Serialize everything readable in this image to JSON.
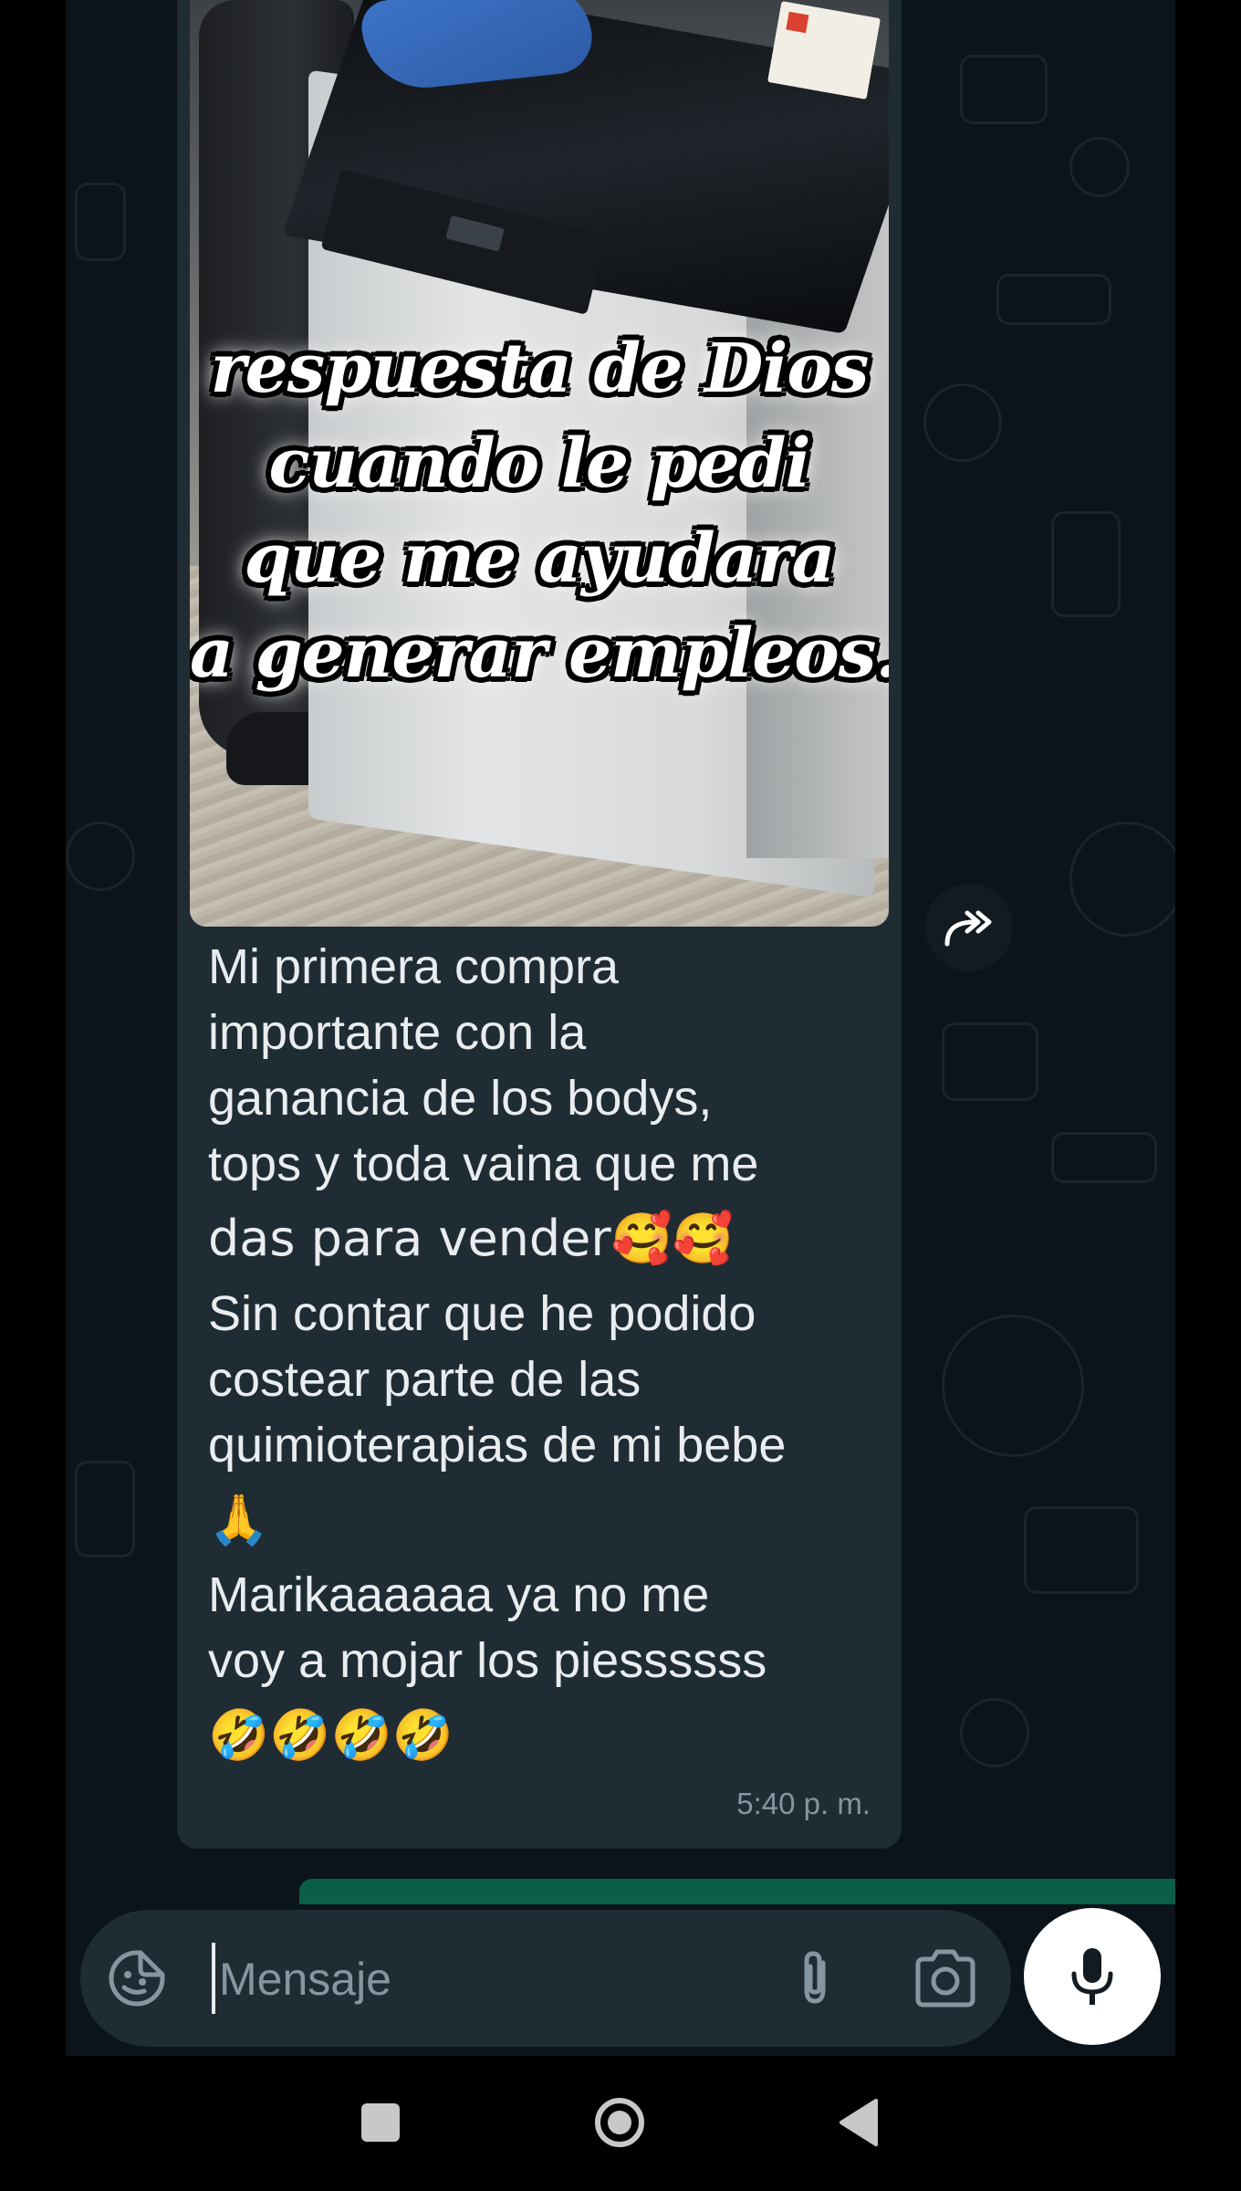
{
  "message": {
    "media_caption_lines": [
      "respuesta de Dios",
      "cuando le pedi",
      "que me ayudara",
      "a generar empleos."
    ],
    "text_lines": [
      "Mi primera compra",
      "importante con la",
      "ganancia de los bodys,",
      "tops y toda vaina que me",
      "das para vender🥰🥰",
      "Sin contar que he podido",
      "costear parte de las",
      "quimioterapias de mi bebe",
      "🙏",
      "Marikaaaaaa ya no me",
      "voy a mojar los piessssss",
      "🤣🤣🤣🤣"
    ],
    "timestamp": "5:40 p. m."
  },
  "composer": {
    "placeholder": "Mensaje"
  },
  "icons": {
    "forward": "forward-icon",
    "emoji": "sticker-smiley-icon",
    "attach": "paperclip-icon",
    "camera": "camera-icon",
    "mic": "microphone-icon",
    "nav_recents": "square-icon",
    "nav_home": "circle-icon",
    "nav_back": "triangle-back-icon"
  },
  "colors": {
    "wallpaper": "#0b141a",
    "bubble": "#1f2c34",
    "text": "#e9edef",
    "muted": "#8696a0",
    "accent_green": "#0b5e48"
  }
}
